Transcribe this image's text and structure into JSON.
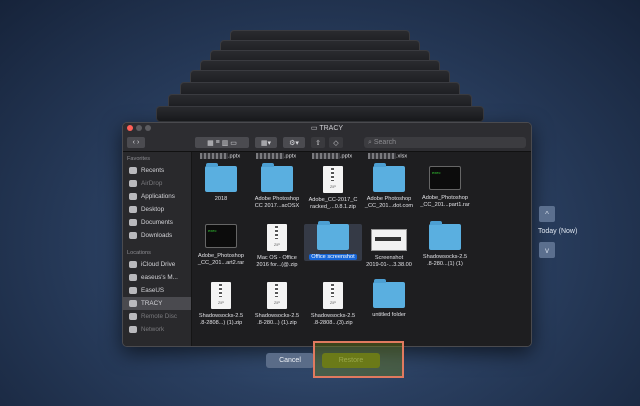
{
  "window": {
    "title": "TRACY"
  },
  "toolbar": {
    "search_placeholder": "Search"
  },
  "sidebar": {
    "favorites_header": "Favorites",
    "favorites": [
      {
        "label": "Recents",
        "state": "normal"
      },
      {
        "label": "AirDrop",
        "state": "dim"
      },
      {
        "label": "Applications",
        "state": "normal"
      },
      {
        "label": "Desktop",
        "state": "normal"
      },
      {
        "label": "Documents",
        "state": "normal"
      },
      {
        "label": "Downloads",
        "state": "normal"
      }
    ],
    "locations_header": "Locations",
    "locations": [
      {
        "label": "iCloud Drive",
        "state": "normal"
      },
      {
        "label": "easeus's M...",
        "state": "normal"
      },
      {
        "label": "EaseUS",
        "state": "normal"
      },
      {
        "label": "TRACY",
        "state": "selected"
      },
      {
        "label": "Remote Disc",
        "state": "dim"
      },
      {
        "label": "Network",
        "state": "dim"
      }
    ]
  },
  "files": {
    "top_row": [
      ".pptx",
      ".pptx",
      ".pptx",
      ".xlsx"
    ],
    "rows": [
      [
        {
          "line1": "2018",
          "line2": "",
          "type": "folder"
        },
        {
          "line1": "Adobe Photoshop",
          "line2": "CC 2017...acOSX",
          "type": "folder"
        },
        {
          "line1": "Adobe_CC-2017_C",
          "line2": "racked_...0.8.1.zip",
          "type": "zip"
        },
        {
          "line1": "Adobe Photoshop",
          "line2": "_CC_201...dot.com",
          "type": "folder"
        },
        {
          "line1": "Adobe_Photoshop",
          "line2": "_CC_201...part1.rar",
          "type": "terminal"
        }
      ],
      [
        {
          "line1": "Adobe_Photoshop",
          "line2": "_CC_201...art2.rar",
          "type": "terminal"
        },
        {
          "line1": "Mac OS - Office",
          "line2": "2016 for...(@.zip",
          "type": "zip"
        },
        {
          "line1": "Office screenshot",
          "line2": "",
          "type": "folder",
          "selected": true
        },
        {
          "line1": "Screenshot",
          "line2": "2019-01-...3.38.00",
          "type": "screenshot"
        },
        {
          "line1": "Shadowsocks-2.5",
          "line2": ".8-280...(1) (1)",
          "type": "folder"
        }
      ],
      [
        {
          "line1": "Shadowsocks-2.5",
          "line2": ".8-2808...) (1).zip",
          "type": "zip"
        },
        {
          "line1": "Shadowsocks-2.5",
          "line2": ".8-280...) (1).zip",
          "type": "zip"
        },
        {
          "line1": "Shadowsocks-2.5",
          "line2": ".8-2808...(3).zip",
          "type": "zip"
        },
        {
          "line1": "untitled folder",
          "line2": "",
          "type": "folder"
        }
      ]
    ],
    "zip_label": "ZIP",
    "terminal_text": "exec"
  },
  "buttons": {
    "cancel": "Cancel",
    "restore": "Restore"
  },
  "timeline": {
    "label": "Today (Now)",
    "up": "^",
    "down": "v"
  },
  "colors": {
    "highlight": "#e07a5f",
    "restore_bg": "#6b7a18",
    "selection": "#1565d8"
  }
}
